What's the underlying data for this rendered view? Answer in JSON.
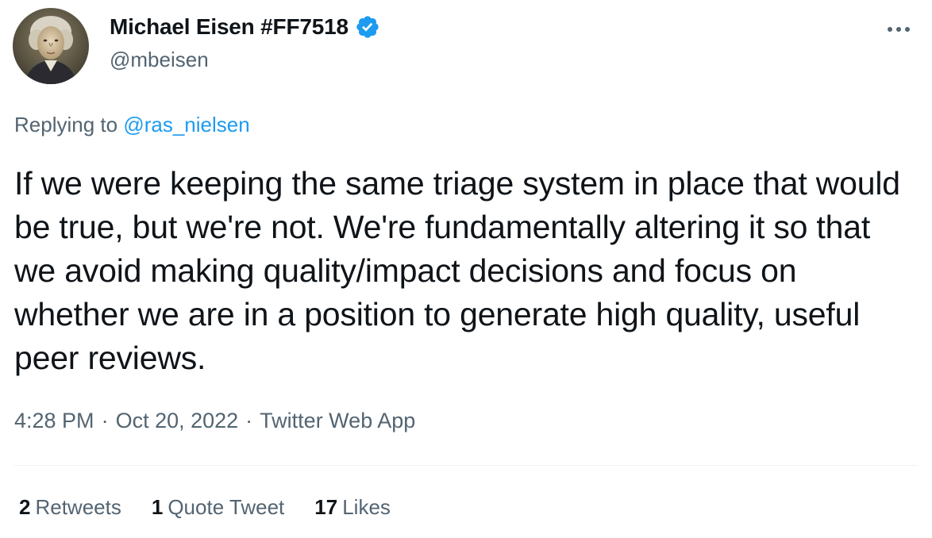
{
  "author": {
    "display_name": "Michael Eisen #FF7518",
    "handle": "@mbeisen",
    "verified": true,
    "avatar": "portrait-avatar"
  },
  "more_icon": "more-options-icon",
  "replying": {
    "prefix": "Replying to",
    "mention": "@ras_nielsen"
  },
  "body": "If we were keeping the same triage system in place that would be true, but we're not. We're fundamentally altering it so that we avoid making quality/impact decisions and focus on whether we are in a position to generate high quality, useful peer reviews.",
  "meta": {
    "time": "4:28 PM",
    "separator": "·",
    "date": "Oct 20, 2022",
    "source": "Twitter Web App"
  },
  "stats": {
    "retweets": {
      "count": "2",
      "label": "Retweets"
    },
    "quotes": {
      "count": "1",
      "label": "Quote Tweet"
    },
    "likes": {
      "count": "17",
      "label": "Likes"
    }
  },
  "colors": {
    "accent": "#1d9bf0",
    "secondary_text": "#536471",
    "primary_text": "#0f1419"
  }
}
